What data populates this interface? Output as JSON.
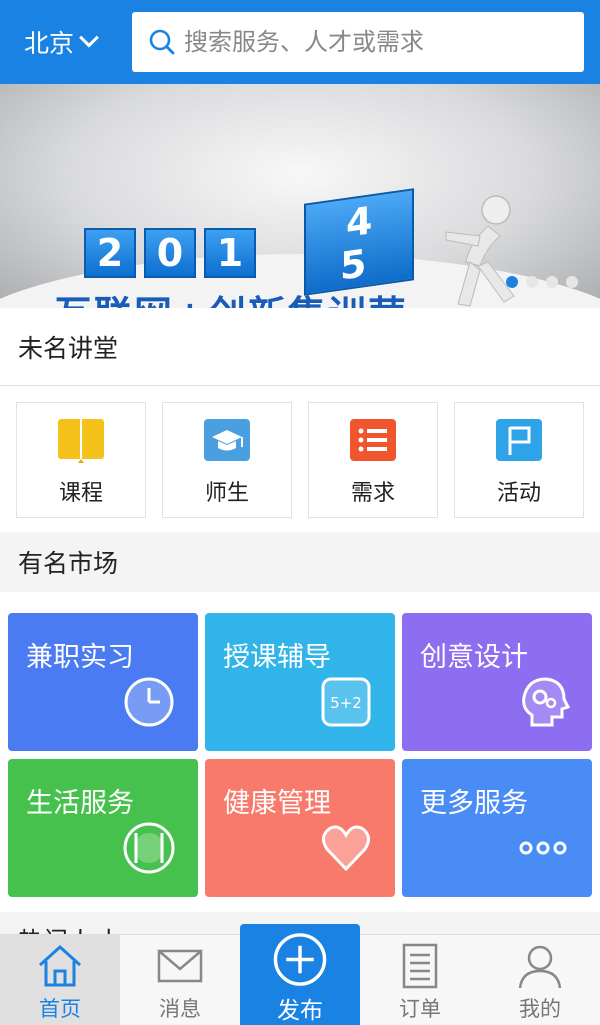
{
  "header": {
    "city": "北京",
    "search_placeholder": "搜索服务、人才或需求"
  },
  "banner": {
    "digits": [
      "2",
      "0",
      "1"
    ],
    "cube_digits": [
      "4",
      "5"
    ],
    "slogan": "互联网+创新集训营",
    "slide_count": 4,
    "active_slide": 1
  },
  "lecture": {
    "title": "未名讲堂",
    "items": [
      {
        "label": "课程",
        "icon": "book-icon",
        "color": "#f5c21b"
      },
      {
        "label": "师生",
        "icon": "graduation-cap-icon",
        "color": "#4a9fe0"
      },
      {
        "label": "需求",
        "icon": "list-icon",
        "color": "#f0562d"
      },
      {
        "label": "活动",
        "icon": "flag-icon",
        "color": "#2ea3e8"
      }
    ]
  },
  "market": {
    "title": "有名市场",
    "tiles": [
      {
        "label": "兼职实习",
        "icon": "clock-icon",
        "color": "#4b7bf2"
      },
      {
        "label": "授课辅导",
        "icon": "math-board-icon",
        "color": "#30b4ea"
      },
      {
        "label": "创意设计",
        "icon": "head-gears-icon",
        "color": "#8e6ef0"
      },
      {
        "label": "生活服务",
        "icon": "dining-icon",
        "color": "#47c14d"
      },
      {
        "label": "健康管理",
        "icon": "heart-icon",
        "color": "#f87a6a"
      },
      {
        "label": "更多服务",
        "icon": "more-dots-icon",
        "color": "#4a8cf5"
      }
    ]
  },
  "next_section_peek": "热门人才",
  "nav": {
    "tabs": [
      {
        "label": "首页",
        "icon": "home-icon",
        "active": true
      },
      {
        "label": "消息",
        "icon": "mail-icon",
        "active": false
      },
      {
        "label": "发布",
        "icon": "plus-circle-icon",
        "active": false
      },
      {
        "label": "订单",
        "icon": "document-icon",
        "active": false
      },
      {
        "label": "我的",
        "icon": "user-icon",
        "active": false
      }
    ]
  },
  "colors": {
    "brand": "#1a82e2",
    "active_dot": "#1a82e2",
    "inactive_dot": "#e6e6e6"
  }
}
